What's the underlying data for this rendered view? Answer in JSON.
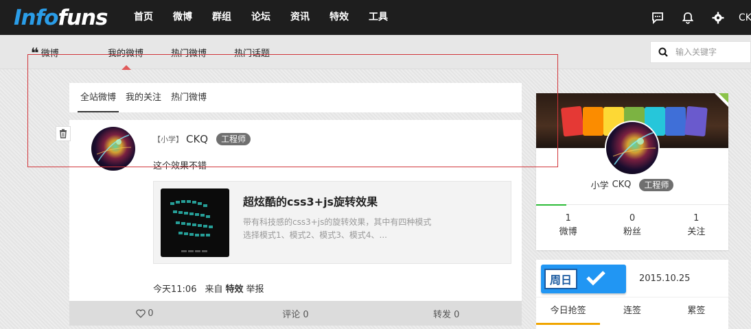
{
  "logo": {
    "part1": "Info",
    "part2": "funs"
  },
  "nav": [
    "首页",
    "微博",
    "群组",
    "论坛",
    "资讯",
    "特效",
    "工具"
  ],
  "top_user": "CKQ",
  "subnav": {
    "brand": "微博",
    "tabs": [
      "我的微博",
      "热门微博",
      "热门话题"
    ],
    "active": 0
  },
  "search": {
    "placeholder": "输入关键字"
  },
  "feed_tabs": [
    "全站微博",
    "我的关注",
    "热门微博"
  ],
  "post": {
    "rank": "【小学】",
    "name": "CKQ",
    "badge": "工程师",
    "text": "这个效果不错",
    "share": {
      "title": "超炫酷的css3+js旋转效果",
      "desc_line1": "带有科技感的css3+js的旋转效果，其中有四种模式",
      "desc_line2": "选择模式1、模式2、模式3、模式4、..."
    },
    "meta": {
      "time": "今天11:06",
      "from": "来自",
      "source": "特效",
      "report": "举报"
    },
    "actions": {
      "like": "0",
      "comment": "评论 0",
      "repost": "转发 0"
    }
  },
  "profile": {
    "rank": "小学",
    "name": "CKQ",
    "badge": "工程师",
    "stats": [
      {
        "num": "1",
        "label": "微博"
      },
      {
        "num": "0",
        "label": "粉丝"
      },
      {
        "num": "1",
        "label": "关注"
      }
    ]
  },
  "signin": {
    "button": "周日",
    "date": "2015.10.25",
    "tabs": [
      "今日抢签",
      "连签",
      "累签"
    ]
  }
}
